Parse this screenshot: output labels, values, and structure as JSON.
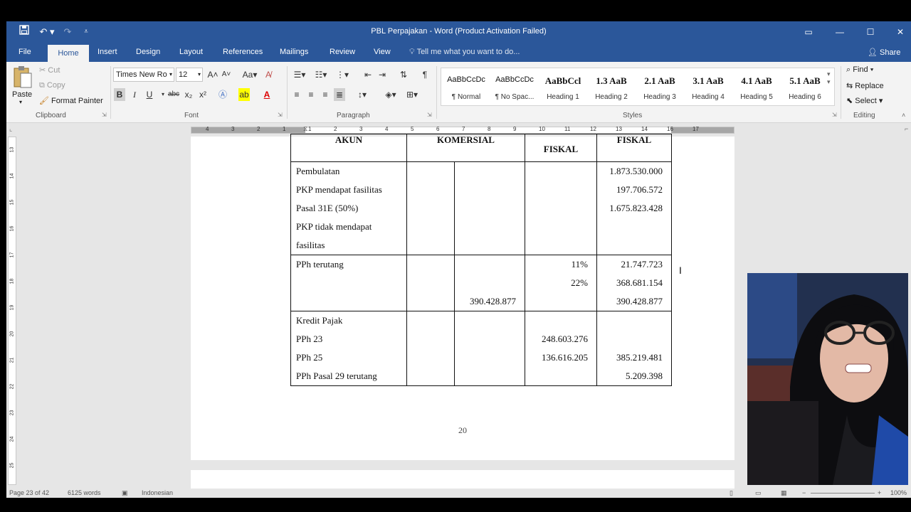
{
  "window": {
    "title": "PBL Perpajakan - Word (Product Activation Failed)",
    "controls": {
      "minimize": "—",
      "maximize": "☐",
      "close": "✕"
    }
  },
  "quick_access": {
    "save_icon": "save-icon",
    "undo_icon": "undo-icon",
    "redo_icon": "redo-icon"
  },
  "tabs": [
    "File",
    "Home",
    "Insert",
    "Design",
    "Layout",
    "References",
    "Mailings",
    "Review",
    "View"
  ],
  "tell_me": "Tell me what you want to do...",
  "share": "Share",
  "ribbon": {
    "clipboard": {
      "paste": "Paste",
      "cut": "Cut",
      "copy": "Copy",
      "format_painter": "Format Painter",
      "label": "Clipboard"
    },
    "font": {
      "family": "Times New Ro",
      "size": "12",
      "label": "Font",
      "bold": "B",
      "italic": "I",
      "underline": "U",
      "strike": "abc",
      "sub": "x₂",
      "sup": "x²",
      "grow": "A",
      "shrink": "A",
      "case": "Aa"
    },
    "paragraph": {
      "label": "Paragraph",
      "pilcrow": "¶"
    },
    "styles": {
      "label": "Styles",
      "items": [
        {
          "sample": "AaBbCcDc",
          "name": "¶ Normal"
        },
        {
          "sample": "AaBbCcDc",
          "name": "¶ No Spac..."
        },
        {
          "sample": "AaBbCcl",
          "name": "Heading 1"
        },
        {
          "sample": "1.3  AaB",
          "name": "Heading 2"
        },
        {
          "sample": "2.1  AaB",
          "name": "Heading 3"
        },
        {
          "sample": "3.1  AaB",
          "name": "Heading 4"
        },
        {
          "sample": "4.1  AaB",
          "name": "Heading 5"
        },
        {
          "sample": "5.1  AaB",
          "name": "Heading 6"
        }
      ]
    },
    "editing": {
      "find": "Find",
      "replace": "Replace",
      "select": "Select",
      "label": "Editing"
    }
  },
  "ruler": {
    "h_numbers": [
      "4",
      "3",
      "2",
      "1",
      "1",
      "2",
      "3",
      "4",
      "5",
      "6",
      "7",
      "8",
      "9",
      "10",
      "11",
      "12",
      "13",
      "14",
      "16",
      "17"
    ],
    "v_numbers": [
      "13",
      "14",
      "15",
      "16",
      "17",
      "18",
      "19",
      "20",
      "21",
      "22",
      "23",
      "24",
      "25"
    ]
  },
  "table": {
    "header": {
      "akun": "AKUN",
      "komersial": "KOMERSIAL",
      "fiskal_a": "FISKAL",
      "fiskal_b": "FISKAL"
    },
    "rows": [
      {
        "akun": [
          "Pembulatan",
          "PKP mendapat fasilitas",
          "Pasal 31E (50%)",
          "PKP tidak mendapat",
          "fasilitas"
        ],
        "k1": [],
        "k2": [],
        "f1": [],
        "f2": [
          "1.873.530.000",
          "197.706.572",
          "1.675.823.428",
          "",
          ""
        ]
      },
      {
        "akun": [
          "PPh terutang",
          "",
          ""
        ],
        "k1": [],
        "k2": [
          "",
          "",
          "390.428.877"
        ],
        "f1": [
          "11%",
          "22%",
          ""
        ],
        "f2": [
          "21.747.723",
          "368.681.154",
          "390.428.877"
        ]
      },
      {
        "akun": [
          "Kredit Pajak",
          "PPh 23",
          "PPh 25",
          "PPh Pasal 29 terutang"
        ],
        "k1": [],
        "k2": [],
        "f1": [
          "",
          "248.603.276",
          "136.616.205",
          ""
        ],
        "f2": [
          "",
          "",
          "385.219.481",
          "5.209.398"
        ]
      }
    ]
  },
  "page_number": "20",
  "status": {
    "page": "Page 23 of 42",
    "words": "6125 words",
    "language": "Indonesian",
    "zoom": "100%"
  }
}
